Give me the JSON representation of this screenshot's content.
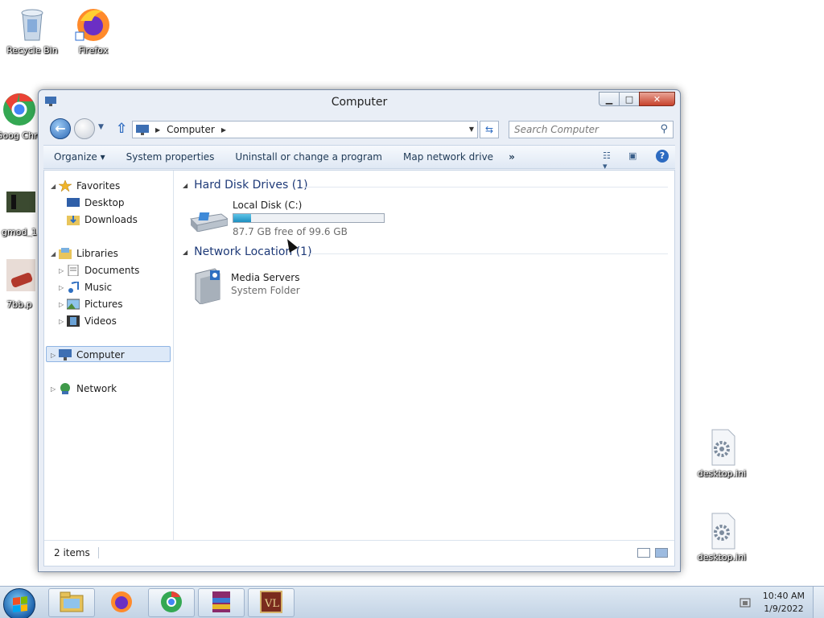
{
  "desktop": {
    "icons": [
      {
        "label": "Recycle Bin"
      },
      {
        "label": "Firefox"
      },
      {
        "label": "Goog Chro"
      },
      {
        "label": "gmod_1"
      },
      {
        "label": "7bb.p"
      },
      {
        "label": "desktop.ini"
      },
      {
        "label": "desktop.ini"
      }
    ]
  },
  "window": {
    "title": "Computer",
    "address": {
      "crumb": "Computer"
    },
    "search": {
      "placeholder": "Search Computer"
    },
    "toolbar": {
      "organize": "Organize ▾",
      "system_properties": "System properties",
      "uninstall": "Uninstall or change a program",
      "map_drive": "Map network drive",
      "more": "»"
    },
    "nav": {
      "favorites": "Favorites",
      "desktop": "Desktop",
      "downloads": "Downloads",
      "libraries": "Libraries",
      "documents": "Documents",
      "music": "Music",
      "pictures": "Pictures",
      "videos": "Videos",
      "computer": "Computer",
      "network": "Network"
    },
    "groups": {
      "hdd": {
        "title": "Hard Disk Drives (1)"
      },
      "network": {
        "title": "Network Location (1)"
      }
    },
    "drive": {
      "name": "Local Disk (C:)",
      "free_text": "87.7 GB free of 99.6 GB",
      "used_fraction": 0.12
    },
    "network_item": {
      "name": "Media Servers",
      "type": "System Folder"
    },
    "status": {
      "count": "2 items"
    }
  },
  "taskbar": {
    "time": "10:40 AM",
    "date": "1/9/2022"
  },
  "colors": {
    "group_header": "#1e3a78",
    "drive_bar": "#1d8fc0",
    "selection": "#dde9f8"
  }
}
